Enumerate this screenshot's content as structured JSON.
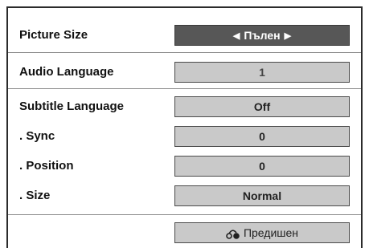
{
  "menu": {
    "picture_size": {
      "label": "Picture Size",
      "value": "Пълен",
      "left_arrow": "◀",
      "right_arrow": "▶"
    },
    "audio_language": {
      "label": "Audio Language",
      "value": "1"
    },
    "subtitle_language": {
      "label": "Subtitle Language",
      "value": "Off"
    },
    "sync": {
      "label": ". Sync",
      "value": "0"
    },
    "position": {
      "label": ". Position",
      "value": "0"
    },
    "size": {
      "label": ". Size",
      "value": "Normal"
    },
    "back": {
      "label": "Предишен",
      "icon": "back-return-icon"
    }
  }
}
